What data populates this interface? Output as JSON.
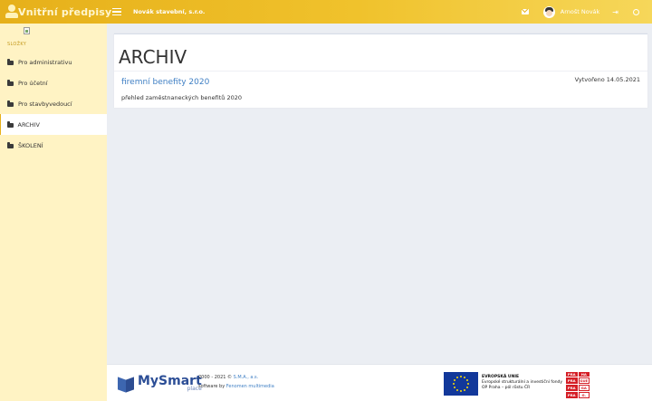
{
  "header": {
    "app_title": "Vnitřní předpisy",
    "company": "Novák stavební, s.r.o.",
    "user_name": "Arnošt Novák",
    "icons": [
      "user-logo-icon",
      "menu-icon",
      "mail-icon",
      "avatar",
      "logout-icon",
      "settings-icon"
    ]
  },
  "sidebar": {
    "section_label": "SLOŽKY",
    "items": [
      {
        "label": "Pro administrativu",
        "icon": "folder-icon",
        "active": false
      },
      {
        "label": "Pro účetní",
        "icon": "folder-icon",
        "active": false
      },
      {
        "label": "Pro stavbyvedoucí",
        "icon": "folder-icon",
        "active": false
      },
      {
        "label": "ARCHIV",
        "icon": "folder-icon",
        "active": true
      },
      {
        "label": "ŠKOLENÍ",
        "icon": "folder-icon",
        "active": false
      }
    ]
  },
  "main": {
    "title": "ARCHIV",
    "document": {
      "title": "firemní benefity 2020",
      "created": "Vytvořeno 14.05.2021",
      "description": "přehled zaměstnaneckých benefitů 2020"
    }
  },
  "footer": {
    "brand": "MySmart",
    "brand_sub": "place",
    "copyright_prefix": "2000 - 2021 © ",
    "copyright_owner": "S.M.A., a.s.",
    "software_prefix": "software by ",
    "software_author": "Fenomen multimedia",
    "eu_line1": "EVROPSKÁ UNIE",
    "eu_line2": "Evropské strukturální a investiční fondy",
    "eu_line3": "OP Praha – pól růstu ČR",
    "praha_cells": [
      "PRA",
      "HA",
      "PRA",
      "GUE",
      "PRA",
      "GA",
      "PRA",
      "G."
    ]
  },
  "colors": {
    "accent": "#e6b01a",
    "sidebar_bg": "#fff3c4",
    "link": "#3f7fc4",
    "brand_blue": "#2c4e96"
  }
}
